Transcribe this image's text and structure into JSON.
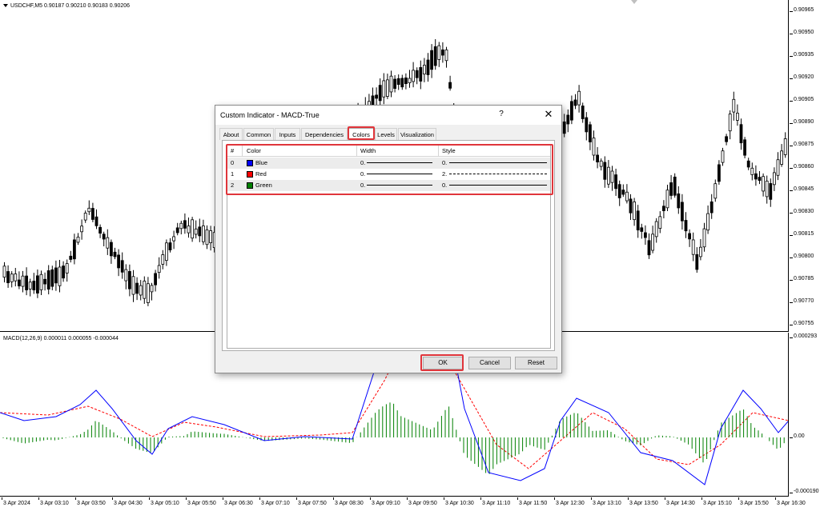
{
  "chart": {
    "header": "USDCHF,M5  0.90187 0.90210 0.90183 0.90206",
    "macd_header": "MACD(12,26,9) 0.000011 0.000055 -0.000044",
    "price_labels": [
      "0.90965",
      "0.90950",
      "0.90935",
      "0.90920",
      "0.90905",
      "0.90890",
      "0.90875",
      "0.90860",
      "0.90845",
      "0.90830",
      "0.90815",
      "0.90800",
      "0.90785",
      "0.90770",
      "0.90755"
    ],
    "macd_labels": [
      "0.000293",
      "0.00",
      "-0.000190"
    ],
    "time_labels": [
      "3 Apr 2024",
      "3 Apr 03:10",
      "3 Apr 03:50",
      "3 Apr 04:30",
      "3 Apr 05:10",
      "3 Apr 05:50",
      "3 Apr 06:30",
      "3 Apr 07:10",
      "3 Apr 07:50",
      "3 Apr 08:30",
      "3 Apr 09:10",
      "3 Apr 09:50",
      "3 Apr 10:30",
      "3 Apr 11:10",
      "3 Apr 11:50",
      "3 Apr 12:30",
      "3 Apr 13:10",
      "3 Apr 13:50",
      "3 Apr 14:30",
      "3 Apr 15:10",
      "3 Apr 15:50",
      "3 Apr 16:30"
    ],
    "colors": {
      "macd_line": "#0000ff",
      "signal_line": "#ff0000",
      "histogram": "#008000",
      "candle": "#000000"
    }
  },
  "dialog": {
    "title": "Custom Indicator - MACD-True",
    "help": "?",
    "close": "✕",
    "tabs": [
      "About",
      "Common",
      "Inputs",
      "Dependencies",
      "Colors",
      "Levels",
      "Visualization"
    ],
    "active_tab": "Colors",
    "table": {
      "headers": [
        "#",
        "Color",
        "Width",
        "Style"
      ],
      "rows": [
        {
          "index": "0",
          "color_name": "Blue",
          "color": "#0000ff",
          "width": "0.",
          "style": "0.",
          "dashed": false
        },
        {
          "index": "1",
          "color_name": "Red",
          "color": "#ff0000",
          "width": "0.",
          "style": "2.",
          "dashed": true
        },
        {
          "index": "2",
          "color_name": "Green",
          "color": "#008000",
          "width": "0.",
          "style": "0.",
          "dashed": false
        }
      ]
    },
    "buttons": {
      "ok": "OK",
      "cancel": "Cancel",
      "reset": "Reset"
    },
    "highlight_color": "#e0353b"
  }
}
